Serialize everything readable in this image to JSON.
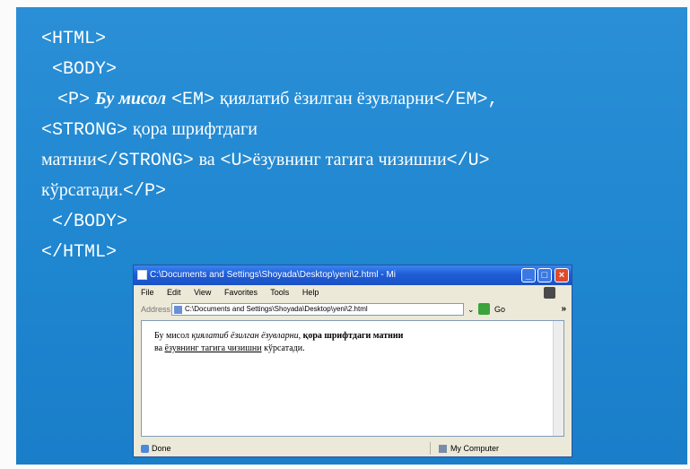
{
  "code": {
    "line1": "<HTML>",
    "line2": "<BODY>",
    "line3_tag_p": "<P>",
    "line3_em_text": "Бу мисол",
    "line3_tag_em": "<EM>",
    "line3_text": "қиялатиб ёзилган ёзувларни",
    "line3_tag_em_close": "</EM>,",
    "line4_tag_strong": "<STRONG>",
    "line4_text": "қора шрифтдаги",
    "line5_text": "матнни",
    "line5_tag_strong_close": "</STRONG>",
    "line5_text2": "ва",
    "line5_tag_u": "<U>",
    "line5_text3": "ёзувнинг тагига чизишни",
    "line5_tag_u_close": "</U>",
    "line6_text": "кўрсатади.",
    "line6_tag_p_close": "</P>",
    "line7": "</BODY>",
    "line8": "</HTML>"
  },
  "browser": {
    "title": "C:\\Documents and Settings\\Shoyada\\Desktop\\yeni\\2.html - Mi",
    "menu": [
      "File",
      "Edit",
      "View",
      "Favorites",
      "Tools",
      "Help"
    ],
    "address_label": "Address",
    "address_value": "C:\\Documents and Settings\\Shoyada\\Desktop\\yeni\\2.html",
    "go_label": "Go",
    "content": {
      "plain1": "Бу мисол",
      "italic": "қиялатиб ёзилган ёзувларни,",
      "bold": "қора шрифтдаги матнни",
      "plain2": "ва",
      "underline": "ёзувнинг тагига чизишни",
      "plain3": "кўрсатади."
    },
    "status_left": "Done",
    "status_right": "My Computer"
  },
  "colors": {
    "panel_blue": "#1f86d0",
    "titlebar_blue": "#1e5cd6"
  }
}
